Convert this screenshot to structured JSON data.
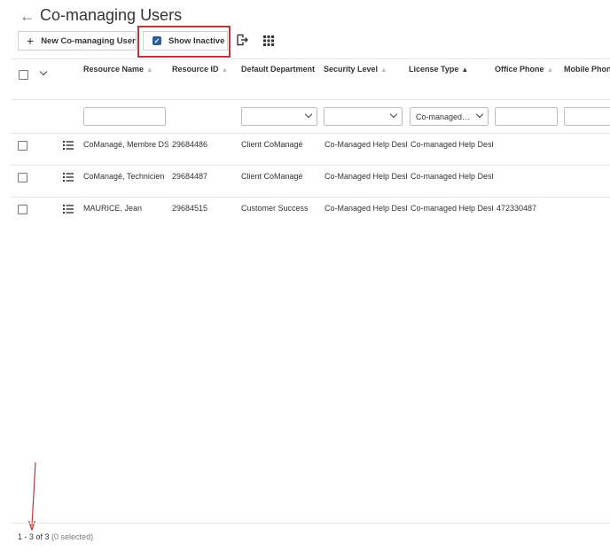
{
  "page": {
    "title": "Co-managing Users",
    "back_icon": "arrow-left-icon"
  },
  "toolbar": {
    "new_label": "New Co-managing User",
    "show_inactive_label": "Show Inactive",
    "show_inactive_checked": true
  },
  "columns": [
    {
      "label": "Resource Name",
      "sort": "none"
    },
    {
      "label": "Resource ID",
      "sort": "none"
    },
    {
      "label": "Default Department",
      "sort": "none"
    },
    {
      "label": "Security Level",
      "sort": "none"
    },
    {
      "label": "License Type",
      "sort": "ascending"
    },
    {
      "label": "Office Phone",
      "sort": "none"
    },
    {
      "label": "Mobile Phone",
      "sort": "none"
    }
  ],
  "filters": {
    "license_type_value": "Co-managed…"
  },
  "rows": [
    {
      "name": "CoManagé, Membre DSI",
      "id": "29684486",
      "department": "Client CoManagé",
      "security": "Co-Managed Help Desk",
      "license": "Co-managed Help Desk",
      "office_phone": ""
    },
    {
      "name": "CoManagé, Technicien",
      "id": "29684487",
      "department": "Client CoManagé",
      "security": "Co-Managed Help Desk",
      "license": "Co-managed Help Desk",
      "office_phone": ""
    },
    {
      "name": "MAURICE, Jean",
      "id": "29684515",
      "department": "Customer Success",
      "security": "Co-Managed Help Desk",
      "license": "Co-managed Help Desk",
      "office_phone": "472330487"
    }
  ],
  "footer": {
    "range": "1 - 3 of 3",
    "selected": "(0 selected)"
  },
  "colors": {
    "accent": "#2a5f9a",
    "highlight": "#b33a3a"
  }
}
